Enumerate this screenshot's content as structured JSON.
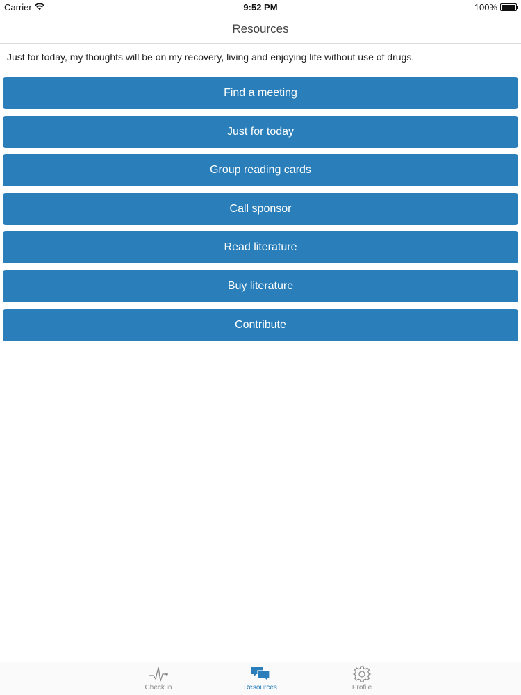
{
  "status_bar": {
    "carrier": "Carrier",
    "time": "9:52 PM",
    "battery": "100%",
    "battery_level": 1.0
  },
  "nav": {
    "title": "Resources"
  },
  "quote": "Just for today, my thoughts will be on my recovery, living and enjoying life without use of drugs.",
  "buttons": [
    "Find a meeting",
    "Just for today",
    "Group reading cards",
    "Call sponsor",
    "Read literature",
    "Buy literature",
    "Contribute"
  ],
  "tabs": {
    "checkin": {
      "label": "Check in",
      "icon": "heartbeat-icon"
    },
    "resources": {
      "label": "Resources",
      "icon": "chat-bubbles-icon",
      "active": true
    },
    "profile": {
      "label": "Profile",
      "icon": "gear-icon"
    }
  },
  "colors": {
    "accent": "#2a7fba",
    "tab_inactive": "#888888"
  }
}
